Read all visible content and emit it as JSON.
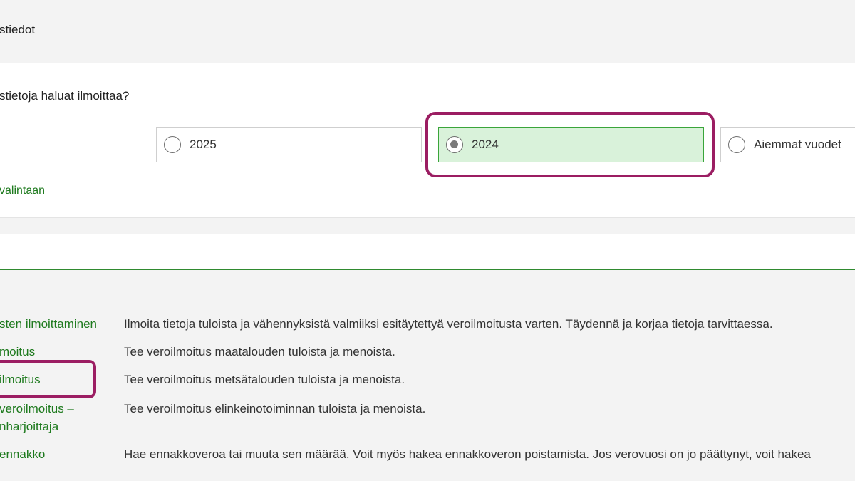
{
  "header": {
    "title": "stiedot"
  },
  "year_selection": {
    "question": "stietoja haluat ilmoittaa?",
    "options": [
      {
        "label": "2025",
        "selected": false
      },
      {
        "label": "2024",
        "selected": true
      },
      {
        "label": "Aiemmat vuodet",
        "selected": false
      }
    ],
    "back_link": "valintaan"
  },
  "services": [
    {
      "link": "sten ilmoittaminen",
      "description": "Ilmoita tietoja tuloista ja vähennyksistä valmiiksi esitäytettyä veroilmoitusta varten. Täydennä ja korjaa tietoja tarvittaessa."
    },
    {
      "link": "moitus",
      "description": "Tee veroilmoitus maatalouden tuloista ja menoista."
    },
    {
      "link": "ilmoitus",
      "description": "Tee veroilmoitus metsätalouden tuloista ja menoista."
    },
    {
      "link_line1": "veroilmoitus –",
      "link_line2": "nharjoittaja",
      "description": "Tee veroilmoitus elinkeinotoiminnan tuloista ja menoista."
    },
    {
      "link": "ennakko",
      "description": "Hae ennakkoveroa tai muuta sen määrää. Voit myös hakea ennakkoveron poistamista. Jos verovuosi on jo päättynyt, voit hakea"
    }
  ],
  "colors": {
    "link_green": "#1e7a1e",
    "selected_bg": "#d9f2da",
    "selected_border": "#3aa53a",
    "highlight": "#9b1d62",
    "divider_green": "#2f8a2f"
  }
}
